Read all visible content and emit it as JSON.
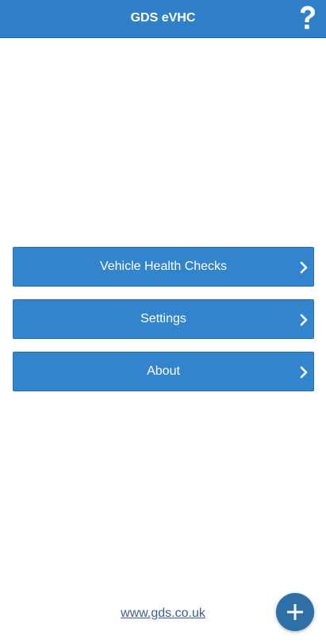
{
  "header": {
    "title": "GDS eVHC",
    "help_icon": "question-mark-icon"
  },
  "menu": {
    "items": [
      {
        "label": "Vehicle Health Checks",
        "icon": "chevron-right-icon"
      },
      {
        "label": "Settings",
        "icon": "chevron-right-icon"
      },
      {
        "label": "About",
        "icon": "chevron-right-icon"
      }
    ]
  },
  "footer": {
    "link_text": "www.gds.co.uk"
  },
  "fab": {
    "icon": "plus-icon"
  },
  "colors": {
    "primary": "#2f80c9",
    "button": "#3284cc",
    "fab": "#2e6fa8",
    "link": "#3d5f8f"
  }
}
